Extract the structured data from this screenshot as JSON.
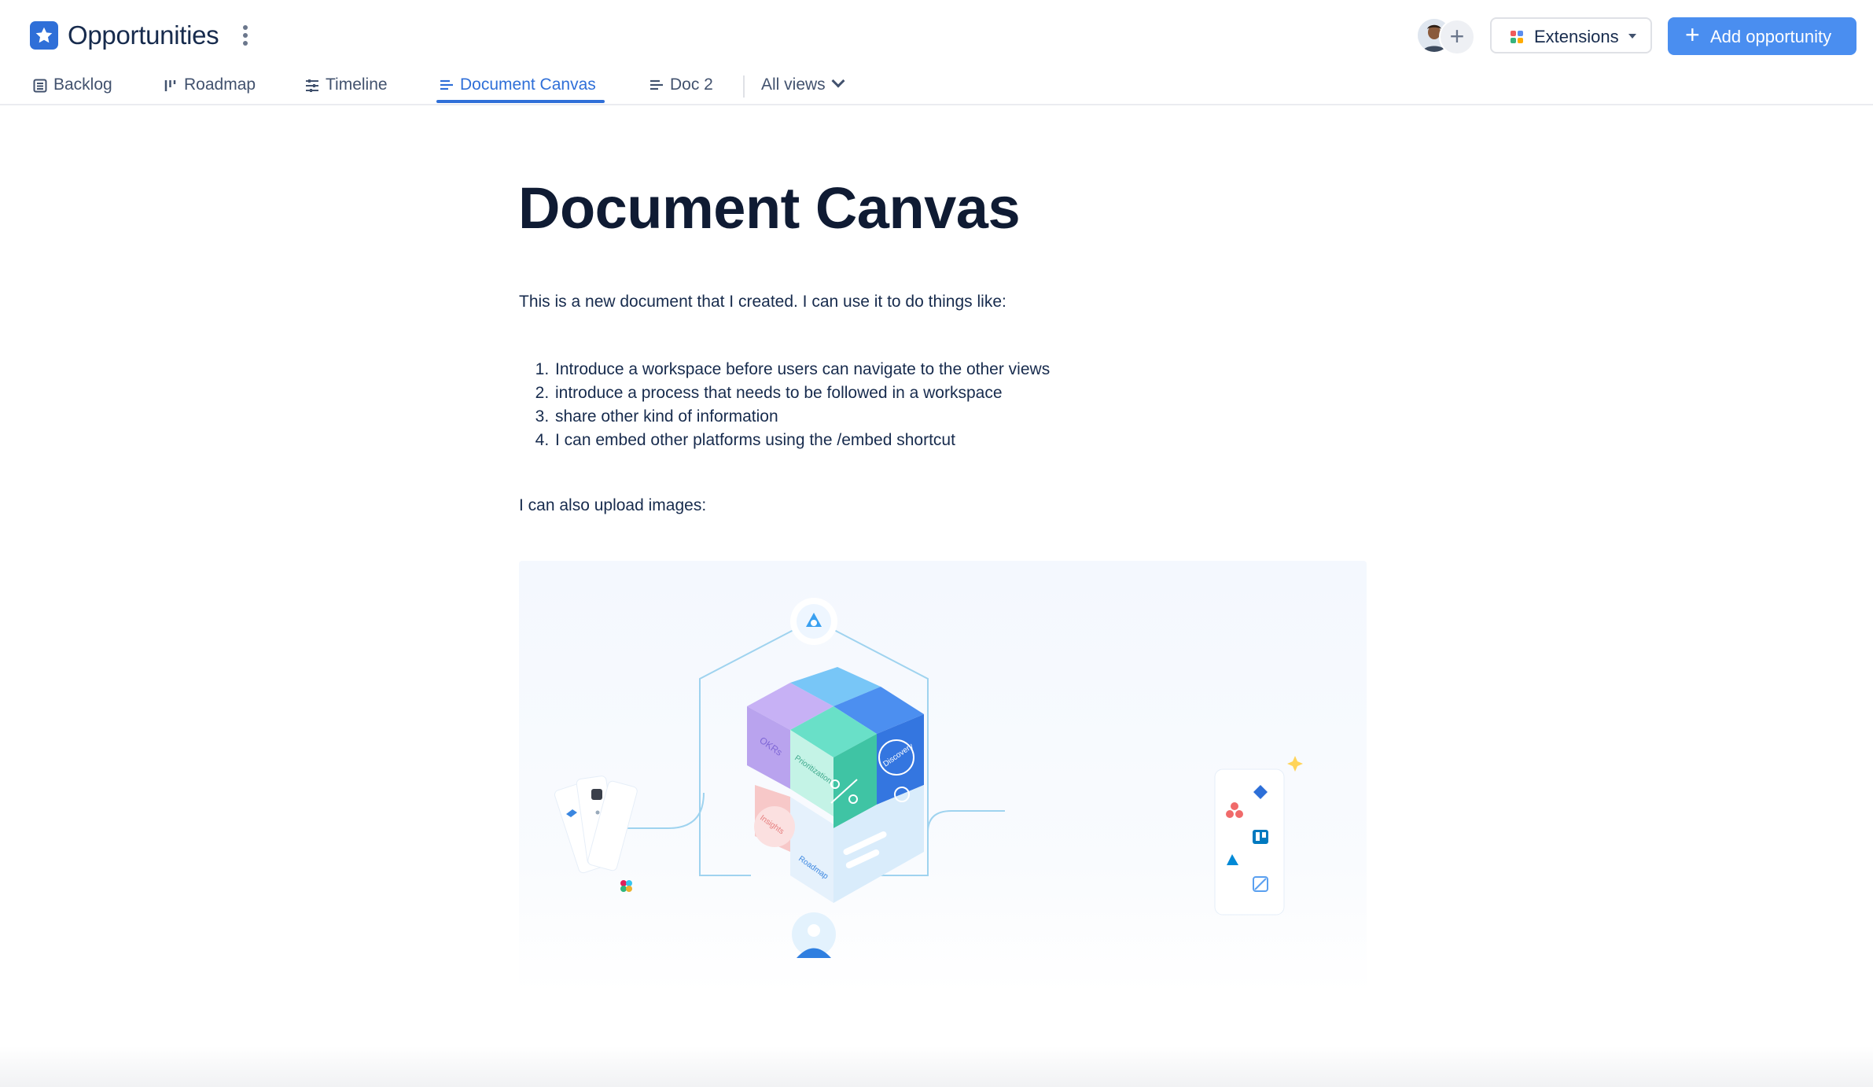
{
  "header": {
    "title": "Opportunities",
    "extensions_label": "Extensions",
    "add_label": "Add opportunity",
    "add_plus": "+",
    "avatar_add": "+"
  },
  "tabs": [
    {
      "label": "Backlog",
      "icon": "table-icon"
    },
    {
      "label": "Roadmap",
      "icon": "roadmap-icon"
    },
    {
      "label": "Timeline",
      "icon": "timeline-icon"
    },
    {
      "label": "Document Canvas",
      "icon": "document-icon",
      "active": true
    },
    {
      "label": "Doc 2",
      "icon": "document-icon"
    }
  ],
  "all_views_label": "All views",
  "document": {
    "title": "Document Canvas",
    "intro": "This is a new document that I created. I can use it to do things like:",
    "list": [
      "Introduce a workspace before users can navigate to the other views",
      "introduce a process that needs to be followed in a workspace",
      "share other kind of information",
      "I can embed other platforms using the /embed shortcut"
    ],
    "images_text": "I can also upload images:",
    "illustration_labels": {
      "okrs": "OKRs",
      "discovery": "Discovery",
      "prioritization": "Prioritization",
      "insights": "Insights",
      "roadmap": "Roadmap"
    }
  },
  "colors": {
    "accent": "#2f6fd8",
    "primary_button": "#4a8ef0",
    "text_dark": "#0f1b33"
  }
}
